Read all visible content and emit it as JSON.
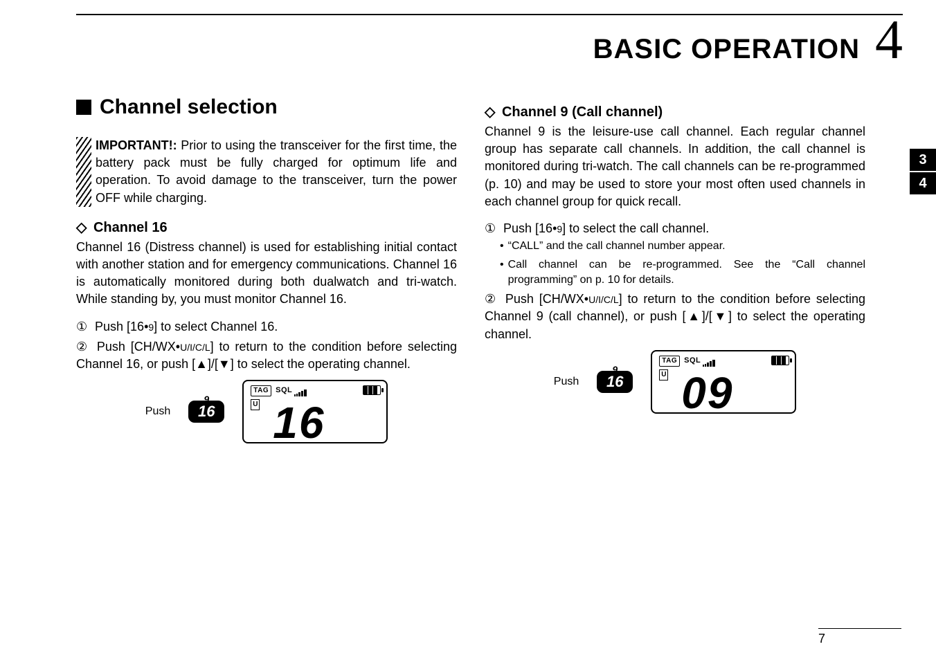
{
  "chapter": {
    "title": "BASIC OPERATION",
    "number": "4"
  },
  "side_tabs": [
    "3",
    "4"
  ],
  "section": {
    "heading": "Channel selection"
  },
  "important": {
    "label": "IMPORTANT!:",
    "text": "Prior to using the transceiver for the first time, the battery pack must be fully charged for optimum life and operation. To avoid damage to the transceiver, turn the power OFF while charging."
  },
  "ch16": {
    "heading": "Channel 16",
    "para": "Channel 16 (Distress channel) is used for establishing initial contact with another station and for emergency communications. Channel 16 is automatically monitored during both dualwatch and tri-watch. While standing by, you must monitor Channel 16.",
    "step1_num": "①",
    "step1_a": "Push [16•",
    "step1_b": "] to select Channel 16.",
    "step2_num": "②",
    "step2_a": "Push [CH/WX•",
    "step2_b": "] to return to the condition before selecting Channel 16, or push [▲]/[▼] to select the operating channel.",
    "small9": "9",
    "uicl": "U/I/C/L"
  },
  "ch9": {
    "heading": "Channel 9 (Call channel)",
    "para": "Channel 9 is the leisure-use call channel. Each regular channel group has separate call channels. In addition, the call channel is monitored during tri-watch. The call channels can be re-programmed (p. 10) and may be used to store your most often used channels in each channel group for quick recall.",
    "step1_num": "①",
    "step1_a": "Push [16•",
    "step1_b": "] to select the call channel.",
    "sub1": "“CALL” and the call channel number appear.",
    "sub2": "Call channel can be re-programmed. See the “Call channel programming” on p. 10 for details.",
    "step2_num": "②",
    "step2_a": "Push [CH/WX•",
    "step2_b": "] to return to the condition before selecting Channel 9 (call channel), or push [▲]/[▼] to select the operating channel.",
    "small9": "9",
    "uicl": "U/I/C/L"
  },
  "display": {
    "push": "Push",
    "btn_top": "9",
    "btn_main": "16",
    "tag": "TAG",
    "sql": "SQL",
    "usa": "U",
    "big16": "16",
    "big09": "09"
  },
  "page_number": "7"
}
